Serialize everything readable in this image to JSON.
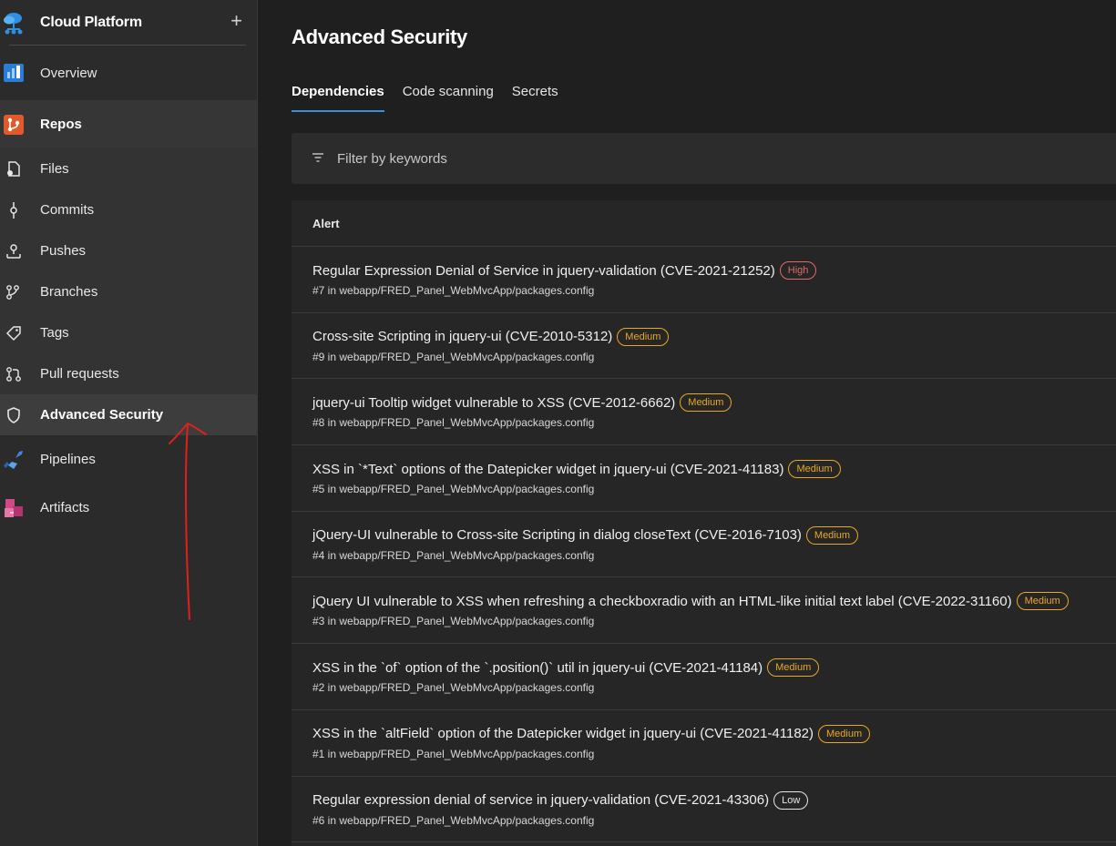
{
  "sidebar": {
    "org_name": "Cloud Platform",
    "add_label": "+",
    "items": [
      {
        "label": "Overview",
        "icon": "overview-icon"
      },
      {
        "label": "Repos",
        "icon": "repos-icon"
      },
      {
        "label": "Files",
        "icon": "files-icon"
      },
      {
        "label": "Commits",
        "icon": "commits-icon"
      },
      {
        "label": "Pushes",
        "icon": "pushes-icon"
      },
      {
        "label": "Branches",
        "icon": "branches-icon"
      },
      {
        "label": "Tags",
        "icon": "tags-icon"
      },
      {
        "label": "Pull requests",
        "icon": "pull-requests-icon"
      },
      {
        "label": "Advanced Security",
        "icon": "shield-icon"
      },
      {
        "label": "Pipelines",
        "icon": "pipelines-icon"
      },
      {
        "label": "Artifacts",
        "icon": "artifacts-icon"
      }
    ]
  },
  "main": {
    "title": "Advanced Security",
    "tabs": [
      {
        "label": "Dependencies",
        "active": true
      },
      {
        "label": "Code scanning",
        "active": false
      },
      {
        "label": "Secrets",
        "active": false
      }
    ],
    "filter_placeholder": "Filter by keywords",
    "table_header": "Alert",
    "alerts": [
      {
        "title": "Regular Expression Denial of Service in jquery-validation (CVE-2021-21252)",
        "severity": "High",
        "location": "#7 in webapp/FRED_Panel_WebMvcApp/packages.config"
      },
      {
        "title": "Cross-site Scripting in jquery-ui (CVE-2010-5312)",
        "severity": "Medium",
        "location": "#9 in webapp/FRED_Panel_WebMvcApp/packages.config"
      },
      {
        "title": "jquery-ui Tooltip widget vulnerable to XSS (CVE-2012-6662)",
        "severity": "Medium",
        "location": "#8 in webapp/FRED_Panel_WebMvcApp/packages.config"
      },
      {
        "title": "XSS in `*Text` options of the Datepicker widget in jquery-ui (CVE-2021-41183)",
        "severity": "Medium",
        "location": "#5 in webapp/FRED_Panel_WebMvcApp/packages.config"
      },
      {
        "title": "jQuery-UI vulnerable to Cross-site Scripting in dialog closeText (CVE-2016-7103)",
        "severity": "Medium",
        "location": "#4 in webapp/FRED_Panel_WebMvcApp/packages.config"
      },
      {
        "title": "jQuery UI vulnerable to XSS when refreshing a checkboxradio with an HTML-like initial text label (CVE-2022-31160)",
        "severity": "Medium",
        "location": "#3 in webapp/FRED_Panel_WebMvcApp/packages.config"
      },
      {
        "title": "XSS in the `of` option of the `.position()` util in jquery-ui (CVE-2021-41184)",
        "severity": "Medium",
        "location": "#2 in webapp/FRED_Panel_WebMvcApp/packages.config"
      },
      {
        "title": "XSS in the `altField` option of the Datepicker widget in jquery-ui (CVE-2021-41182)",
        "severity": "Medium",
        "location": "#1 in webapp/FRED_Panel_WebMvcApp/packages.config"
      },
      {
        "title": "Regular expression denial of service in jquery-validation (CVE-2021-43306)",
        "severity": "Low",
        "location": "#6 in webapp/FRED_Panel_WebMvcApp/packages.config"
      }
    ]
  },
  "colors": {
    "accent": "#3b8fd9",
    "high": "#e06a6a",
    "medium": "#e8a923",
    "low": "#e6e6e6",
    "annotation": "#e0201b"
  }
}
